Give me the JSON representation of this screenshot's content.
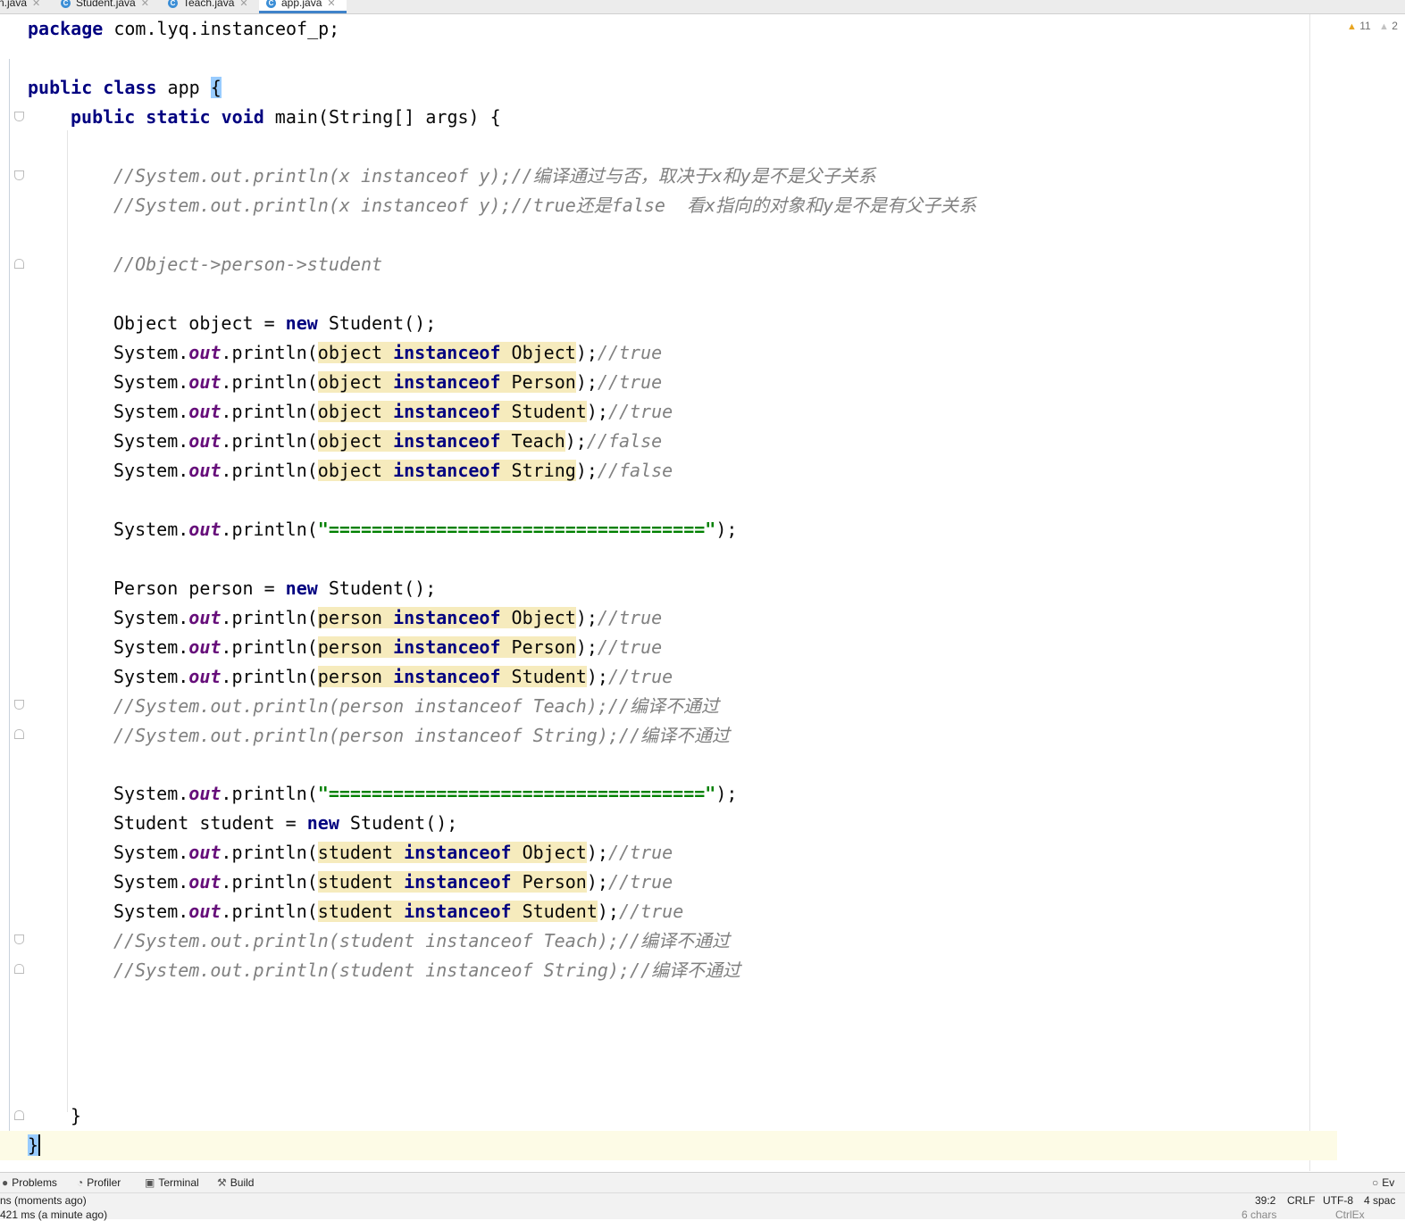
{
  "tabs": [
    {
      "label": "n.java",
      "type": "class",
      "active": false
    },
    {
      "label": "Student.java",
      "type": "class",
      "active": false
    },
    {
      "label": "Teach.java",
      "type": "class",
      "active": false
    },
    {
      "label": "app.java",
      "type": "class",
      "active": true
    }
  ],
  "inspections": {
    "warnings": "11",
    "weak_warnings": "2"
  },
  "code": {
    "package_kw": "package",
    "package_name": " com.lyq.instanceof_p;",
    "class_kw": "public class",
    "class_name": " app ",
    "open_brace": "{",
    "main_kw": "public static void",
    "main_sig": " main(String[] args) {",
    "comment1": "//System.out.println(x instanceof y);//编译通过与否，取决于x和y是不是父子关系",
    "comment2": "//System.out.println(x instanceof y);//true还是false  看x指向的对象和y是不是有父子关系",
    "comment3": "//Object->person->student",
    "new_kw": "new",
    "instanceof_kw": "instanceof",
    "system": "System.",
    "out": "out",
    "println": ".println(",
    "decl_object": "Object object = ",
    "decl_person": "Person person = ",
    "decl_student": "Student student = ",
    "ctor": " Student();",
    "object_checks": [
      {
        "var": "object",
        "type": " Object",
        "result": "//true"
      },
      {
        "var": "object",
        "type": " Person",
        "result": "//true"
      },
      {
        "var": "object",
        "type": " Student",
        "result": "//true"
      },
      {
        "var": "object",
        "type": " Teach",
        "result": "//false"
      },
      {
        "var": "object",
        "type": " String",
        "result": "//false"
      }
    ],
    "separator": "\"===================================\"",
    "person_checks": [
      {
        "var": "person",
        "type": " Object",
        "result": "//true"
      },
      {
        "var": "person",
        "type": " Person",
        "result": "//true"
      },
      {
        "var": "person",
        "type": " Student",
        "result": "//true"
      }
    ],
    "person_commented": [
      "//System.out.println(person instanceof Teach);//编译不通过",
      "//System.out.println(person instanceof String);//编译不通过"
    ],
    "student_checks": [
      {
        "var": "student",
        "type": " Object",
        "result": "//true"
      },
      {
        "var": "student",
        "type": " Person",
        "result": "//true"
      },
      {
        "var": "student",
        "type": " Student",
        "result": "//true"
      }
    ],
    "student_commented": [
      "//System.out.println(student instanceof Teach);//编译不通过",
      "//System.out.println(student instanceof String);//编译不通过"
    ],
    "close_method": "}",
    "close_class": "}"
  },
  "tool_windows": [
    "Problems",
    "Profiler",
    "Terminal",
    "Build"
  ],
  "tool_right": "Ev",
  "status": {
    "message": "ns (moments ago)",
    "message2": "421 ms (a minute ago)",
    "position": "39:2",
    "line_sep": "CRLF",
    "encoding": "UTF-8",
    "indent": "4 spac",
    "sub1": "6 chars",
    "sub2": "CtrlEx"
  },
  "colors": {
    "keyword": "#000080",
    "field": "#660e7a",
    "comment": "#808080",
    "string": "#008000",
    "highlight": "#f6ebbd",
    "brace": "#99ccff"
  }
}
